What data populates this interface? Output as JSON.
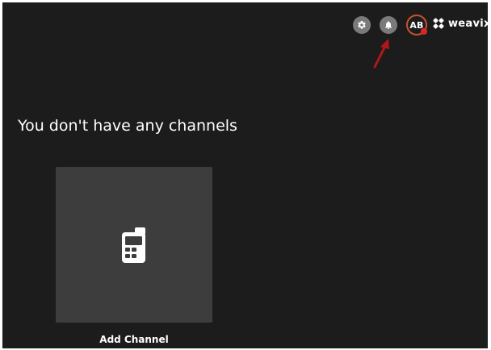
{
  "header": {
    "settings_icon": "gear-icon",
    "notifications_icon": "bell-icon",
    "avatar_initials": "AB",
    "brand_name": "weavix",
    "brand_icon": "weavix-logo-icon"
  },
  "main": {
    "empty_title": "You don't have any channels",
    "add_channel_label": "Add Channel",
    "add_channel_icon": "radio-device-icon"
  },
  "annotation": {
    "arrow_icon": "annotation-arrow-icon"
  },
  "colors": {
    "background": "#1c1c1c",
    "card": "#3d3d3d",
    "icon_button": "#7a7a7a",
    "avatar_ring": "#c4522f",
    "status_dot": "#e02424",
    "annotation_arrow": "#b01818",
    "text": "#ffffff"
  }
}
